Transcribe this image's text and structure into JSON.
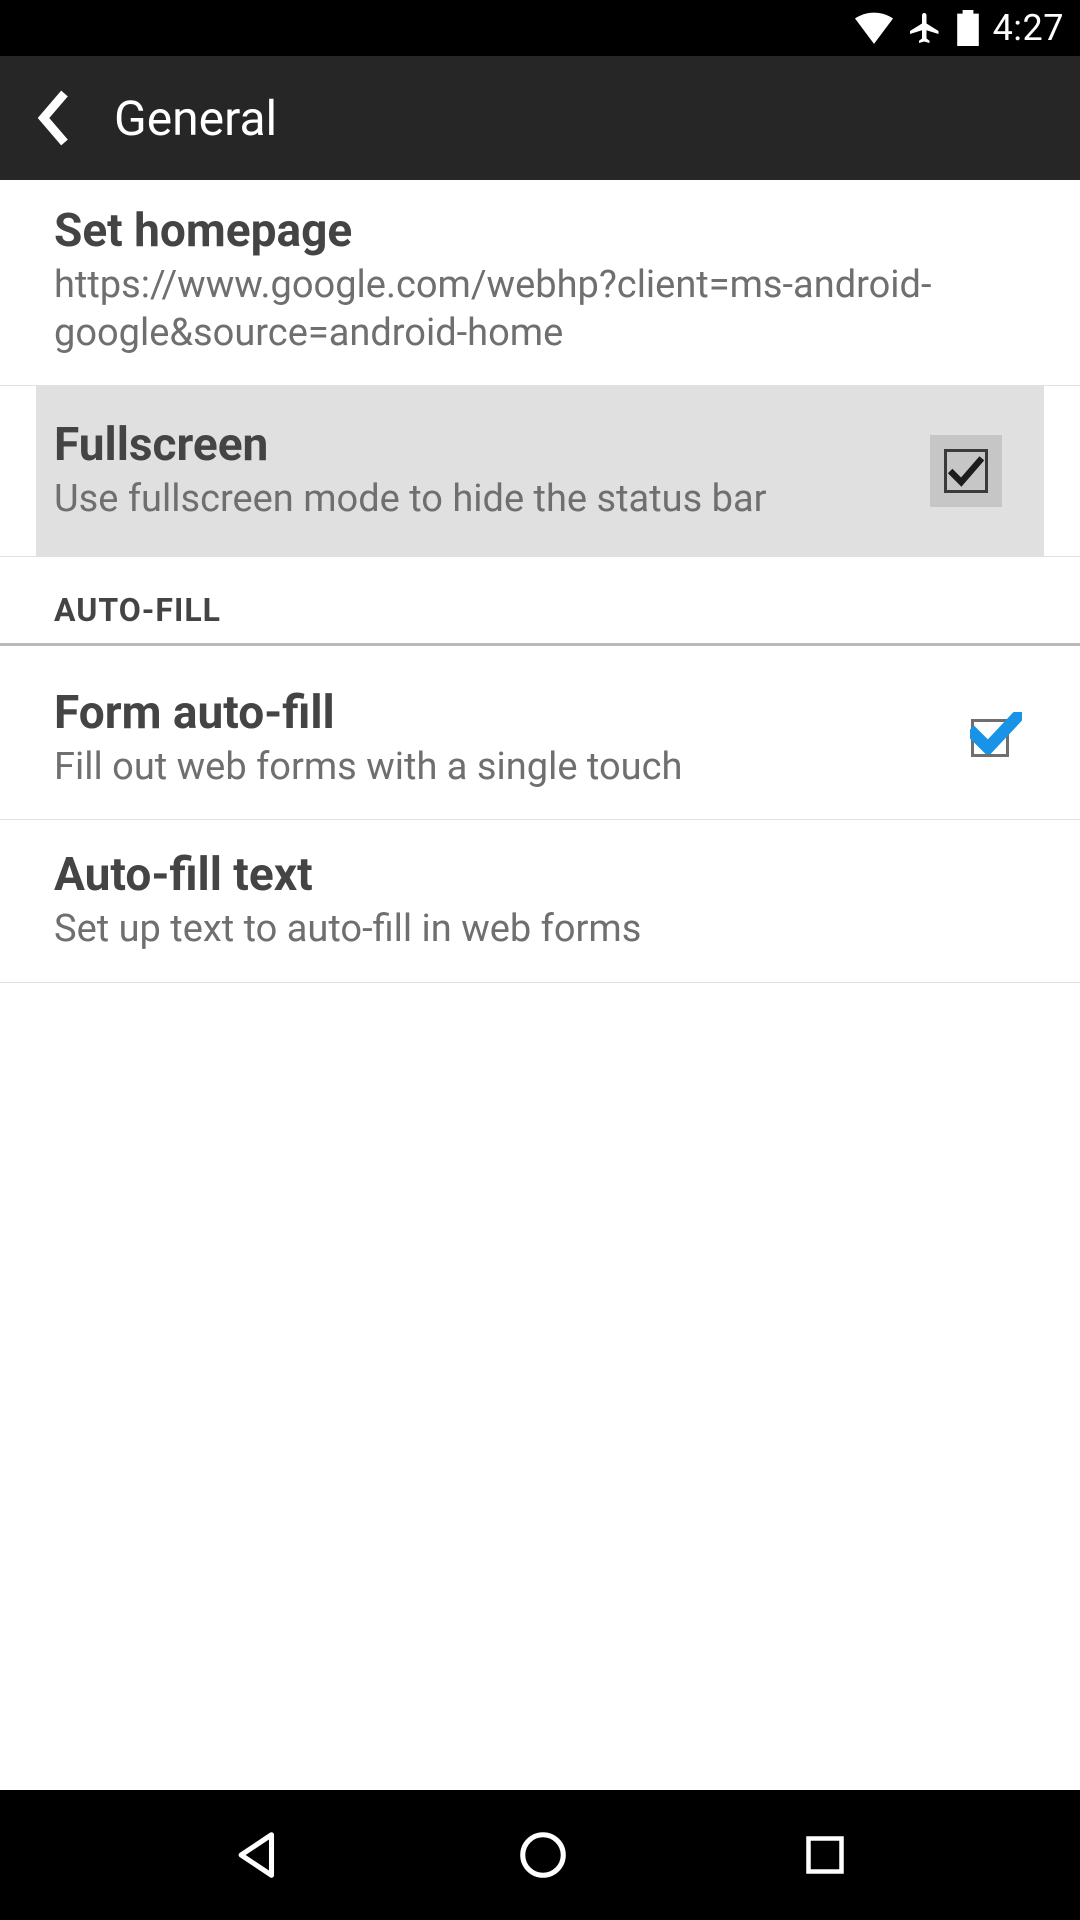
{
  "status": {
    "time": "4:27"
  },
  "header": {
    "title": "General"
  },
  "settings": {
    "homepage": {
      "title": "Set homepage",
      "value": "https://www.google.com/webhp?client=ms-android-google&source=android-home"
    },
    "fullscreen": {
      "title": "Fullscreen",
      "subtitle": "Use fullscreen mode to hide the status bar",
      "checked": true
    }
  },
  "sections": {
    "autofill": {
      "header": "AUTO-FILL",
      "form_autofill": {
        "title": "Form auto-fill",
        "subtitle": "Fill out web forms with a single touch",
        "checked": true
      },
      "autofill_text": {
        "title": "Auto-fill text",
        "subtitle": "Set up text to auto-fill in web forms"
      }
    }
  }
}
